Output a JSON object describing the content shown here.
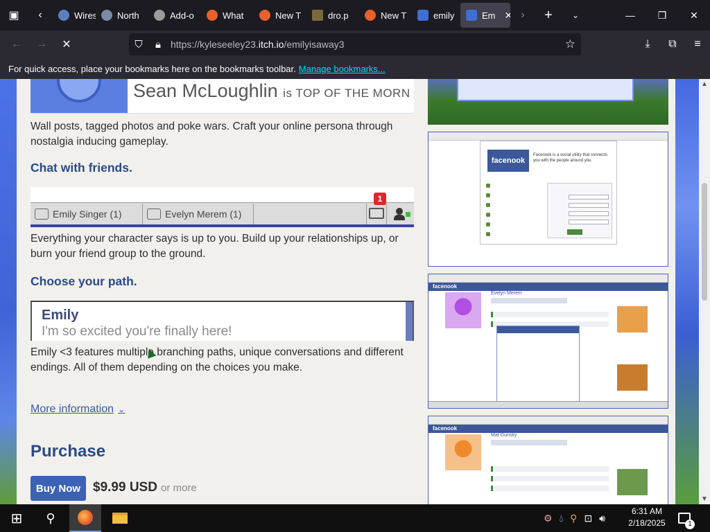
{
  "tabs": [
    {
      "label": "Wiresh",
      "favicon_color": "#5b7fbf"
    },
    {
      "label": "North",
      "favicon_color": "#7a8aa3"
    },
    {
      "label": "Add-o",
      "favicon_color": "#9b9b9b"
    },
    {
      "label": "What",
      "favicon_color": "#e9602b"
    },
    {
      "label": "New T",
      "favicon_color": "#e9602b"
    },
    {
      "label": "dro.p",
      "favicon_color": "#7a6a3a"
    },
    {
      "label": "New T",
      "favicon_color": "#e9602b"
    },
    {
      "label": "emily",
      "favicon_color": "#3e6fd1"
    },
    {
      "label": "Em",
      "favicon_color": "#3e6fd1",
      "active": true
    }
  ],
  "url": {
    "prefix": "https://kyleseeley23.",
    "host": "itch.io",
    "path": "/emilyisaway3"
  },
  "bookmarks": {
    "text": "For quick access, place your bookmarks here on the bookmarks toolbar.",
    "link": "Manage bookmarks..."
  },
  "page": {
    "banner_name": "Sean McLoughlin",
    "banner_status": "is TOP OF THE MORN",
    "intro": "Wall posts, tagged photos and poke wars. Craft your online persona through nostalgia inducing gameplay.",
    "heading_chat": "Chat with friends.",
    "chat_contacts": [
      "Emily Singer (1)",
      "Evelyn Merem (1)"
    ],
    "chat_badge": "1",
    "para_chat": "Everything your character says is up to you. Build up your relationships up, or burn your friend group to the ground.",
    "heading_path": "Choose your path.",
    "dialog_speaker": "Emily",
    "dialog_line": "I'm so excited you're finally here!",
    "para_path": "Emily <3 features multiple branching paths, unique conversations and different endings. All of them depending on the choices you make.",
    "more_info": "More information",
    "purchase_heading": "Purchase",
    "buy_button": "Buy Now",
    "price": "$9.99 USD",
    "or_more": "or more"
  },
  "screenshots": {
    "facenook_logo": "facenook",
    "facenook_tagline": "Facenook is a social utility that connects you with the people around you.",
    "shot3_name": "Evelyn Merem",
    "shot4_name": "Mat Gunsky"
  },
  "taskbar": {
    "time": "6:31 AM",
    "date": "2/18/2025",
    "notif_count": "1"
  }
}
